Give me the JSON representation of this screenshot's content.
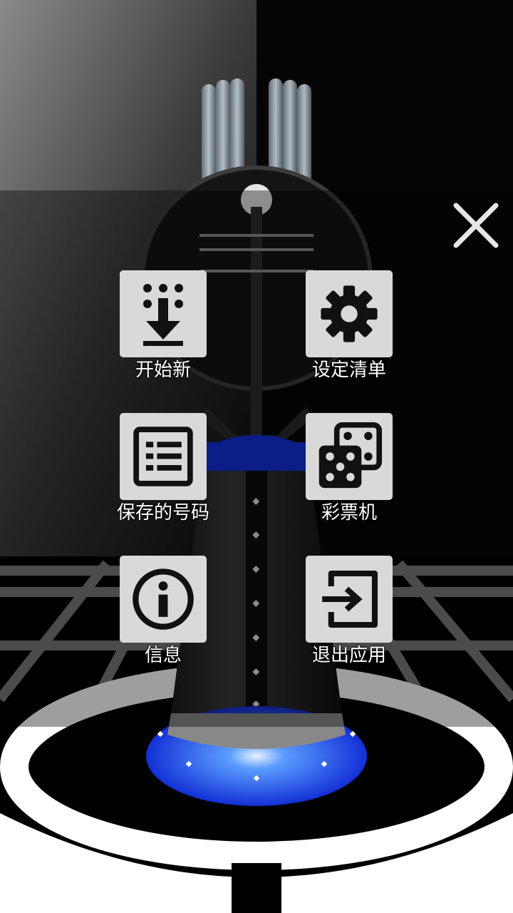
{
  "menu": {
    "items": [
      {
        "id": "start-new",
        "label": "开始新",
        "icon": "numbers-download-icon"
      },
      {
        "id": "set-list",
        "label": "设定清单",
        "icon": "gear-icon"
      },
      {
        "id": "saved-numbers",
        "label": "保存的号码",
        "icon": "list-icon"
      },
      {
        "id": "lottery-machine",
        "label": "彩票机",
        "icon": "dice-icon"
      },
      {
        "id": "info",
        "label": "信息",
        "icon": "info-icon"
      },
      {
        "id": "exit-app",
        "label": "退出应用",
        "icon": "exit-icon"
      }
    ],
    "close_icon": "close-icon"
  },
  "colors": {
    "tile_background": "#d9d9d9",
    "icon_color": "#111111",
    "machine_accent": "#1230d8",
    "floor_lines": "#7a7a7a"
  }
}
